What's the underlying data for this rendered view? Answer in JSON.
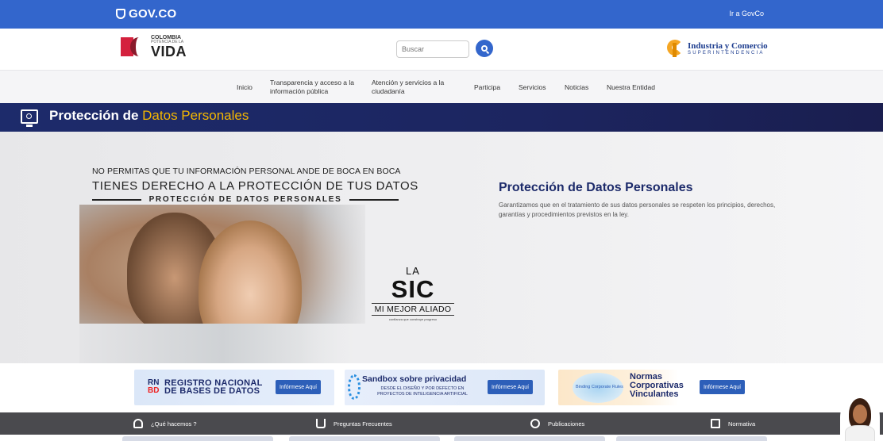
{
  "gov": {
    "logo": "GOV.CO",
    "goto": "Ir a GovCo"
  },
  "brand": {
    "colombia_top": "COLOMBIA",
    "colombia_sub": "POTENCIA DE LA",
    "colombia_word": "VIDA",
    "sic_line1": "Industria y Comercio",
    "sic_line2": "SUPERINTENDENCIA"
  },
  "search": {
    "placeholder": "Buscar"
  },
  "nav": {
    "inicio": "Inicio",
    "transparencia_1": "Transparencia y acceso a la",
    "transparencia_2": "información pública",
    "atencion_1": "Atención y servicios a la",
    "atencion_2": "ciudadanía",
    "participa": "Participa",
    "servicios": "Servicios",
    "noticias": "Noticias",
    "entidad": "Nuestra Entidad"
  },
  "title": {
    "strong": "Protección de",
    "highlight": "Datos Personales"
  },
  "hero": {
    "line1": "NO PERMITAS QUE TU INFORMACIÓN PERSONAL ANDE DE BOCA EN BOCA",
    "line2": "TIENES DERECHO A LA PROTECCIÓN DE TUS DATOS",
    "line3": "PROTECCIÓN DE DATOS PERSONALES",
    "stamp_la": "LA",
    "stamp_sic": "SIC",
    "stamp_ally": "MI MEJOR ALIADO",
    "stamp_sub": "confianza que construye progreso",
    "heading": "Protección de Datos Personales",
    "paragraph": "Garantizamos que en el tratamiento de sus datos personales se respeten los principios, derechos, garantías y procedimientos previstos en la ley."
  },
  "banners": {
    "rnbd_rn": "RN",
    "rnbd_bd": "BD",
    "rnbd_title1": "REGISTRO NACIONAL",
    "rnbd_title2": "DE BASES DE DATOS",
    "sandbox_title": "Sandbox sobre privacidad",
    "sandbox_sub1": "DESDE EL DISEÑO Y POR DEFECTO EN",
    "sandbox_sub2": "PROYECTOS DE INTELIGENCIA ARTIFICIAL",
    "normas_globe": "Binding Corporate Rules",
    "normas_1": "Normas",
    "normas_2": "Corporativas",
    "normas_3": "Vinculantes",
    "cta": "Infórmese Aquí"
  },
  "bottom": {
    "que": "¿Qué hacemos ?",
    "preguntas": "Preguntas Frecuentes",
    "publicaciones": "Publicaciones",
    "normativa": "Normativa"
  }
}
